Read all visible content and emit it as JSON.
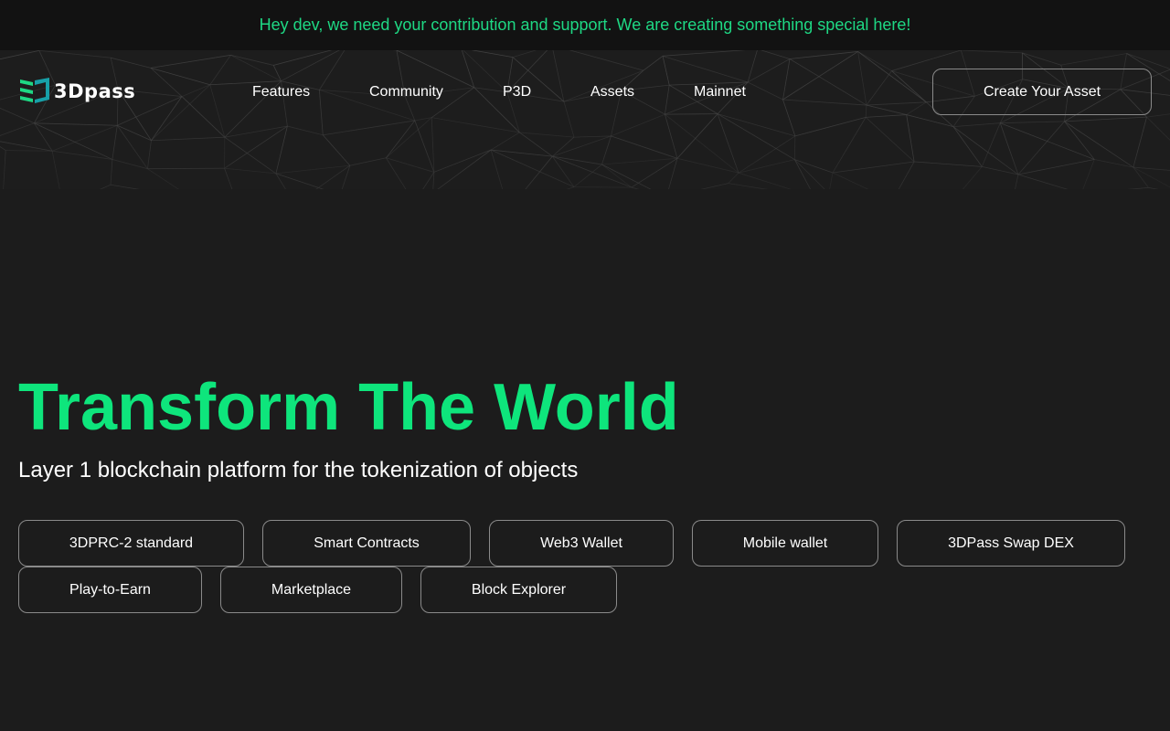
{
  "announcement": "Hey dev, we need your contribution and support. We are creating something special here!",
  "logo": {
    "text": "3Dpass",
    "icon": "3dpass-logo-mark"
  },
  "nav": {
    "items": [
      {
        "label": "Features"
      },
      {
        "label": "Community"
      },
      {
        "label": "P3D"
      },
      {
        "label": "Assets"
      },
      {
        "label": "Mainnet"
      }
    ],
    "cta_label": "Create Your Asset"
  },
  "hero": {
    "title": "Transform The World",
    "subtitle": "Layer 1 blockchain platform for the tokenization of objects",
    "features": [
      {
        "label": "3DPRC-2 standard"
      },
      {
        "label": "Smart Contracts"
      },
      {
        "label": "Web3 Wallet"
      },
      {
        "label": "Mobile wallet"
      },
      {
        "label": "3DPass Swap DEX"
      },
      {
        "label": "Play-to-Earn"
      },
      {
        "label": "Marketplace"
      },
      {
        "label": "Block Explorer"
      }
    ]
  },
  "colors": {
    "accent": "#0ee57c",
    "announcement_text": "#1ed884",
    "background": "#1c1c1c",
    "announcement_bg": "#121212",
    "button_border": "#8a8a8a"
  }
}
